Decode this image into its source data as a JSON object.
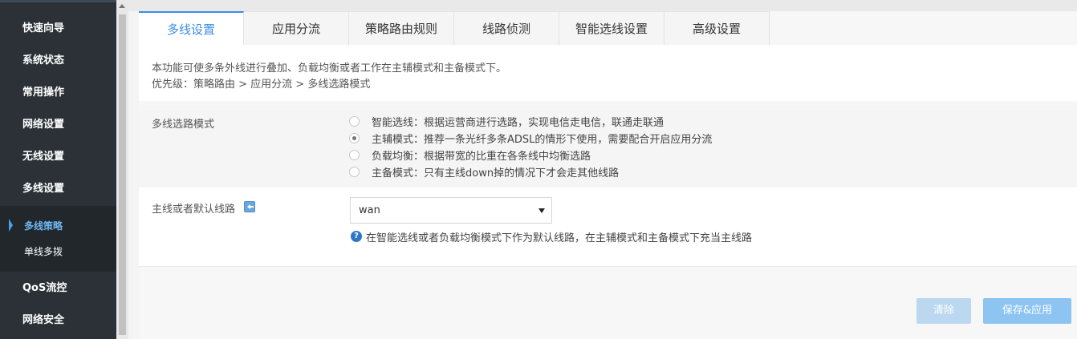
{
  "sidebar": {
    "items": [
      {
        "label": "快速向导"
      },
      {
        "label": "系统状态"
      },
      {
        "label": "常用操作"
      },
      {
        "label": "网络设置"
      },
      {
        "label": "无线设置"
      },
      {
        "label": "多线设置"
      }
    ],
    "subitems": [
      {
        "label": "多线策略",
        "active": true
      },
      {
        "label": "单线多拨",
        "active": false
      }
    ],
    "bottom_items": [
      {
        "label": "QoS流控"
      },
      {
        "label": "网络安全"
      }
    ]
  },
  "tabs": [
    {
      "label": "多线设置",
      "active": true
    },
    {
      "label": "应用分流"
    },
    {
      "label": "策略路由规则"
    },
    {
      "label": "线路侦测"
    },
    {
      "label": "智能选线设置"
    },
    {
      "label": "高级设置"
    }
  ],
  "description": {
    "line1": "本功能可使多条外线进行叠加、负载均衡或者工作在主辅模式和主备模式下。",
    "line2": "优先级：策略路由 > 应用分流 > 多线选路模式"
  },
  "mode": {
    "label": "多线选路模式",
    "options": [
      {
        "label": "智能选线：根据运营商进行选路，实现电信走电信，联通走联通",
        "checked": false
      },
      {
        "label": "主辅模式：推荐一条光纤多条ADSL的情形下使用，需要配合开启应用分流",
        "checked": true
      },
      {
        "label": "负载均衡：根据带宽的比重在各条线中均衡选路",
        "checked": false
      },
      {
        "label": "主备模式：只有主线down掉的情况下才会走其他线路",
        "checked": false
      }
    ]
  },
  "main_line": {
    "label": "主线或者默认线路",
    "selected": "wan",
    "help": "在智能选线或者负载均衡模式下作为默认线路，在主辅模式和主备模式下充当主线路"
  },
  "buttons": {
    "clear": "清除",
    "save": "保存&应用"
  },
  "colors": {
    "sidebar_bg": "#2b3137",
    "accent": "#3a8ee6",
    "save_button": "#8dc4f2",
    "clear_button": "#bcd7f0"
  }
}
